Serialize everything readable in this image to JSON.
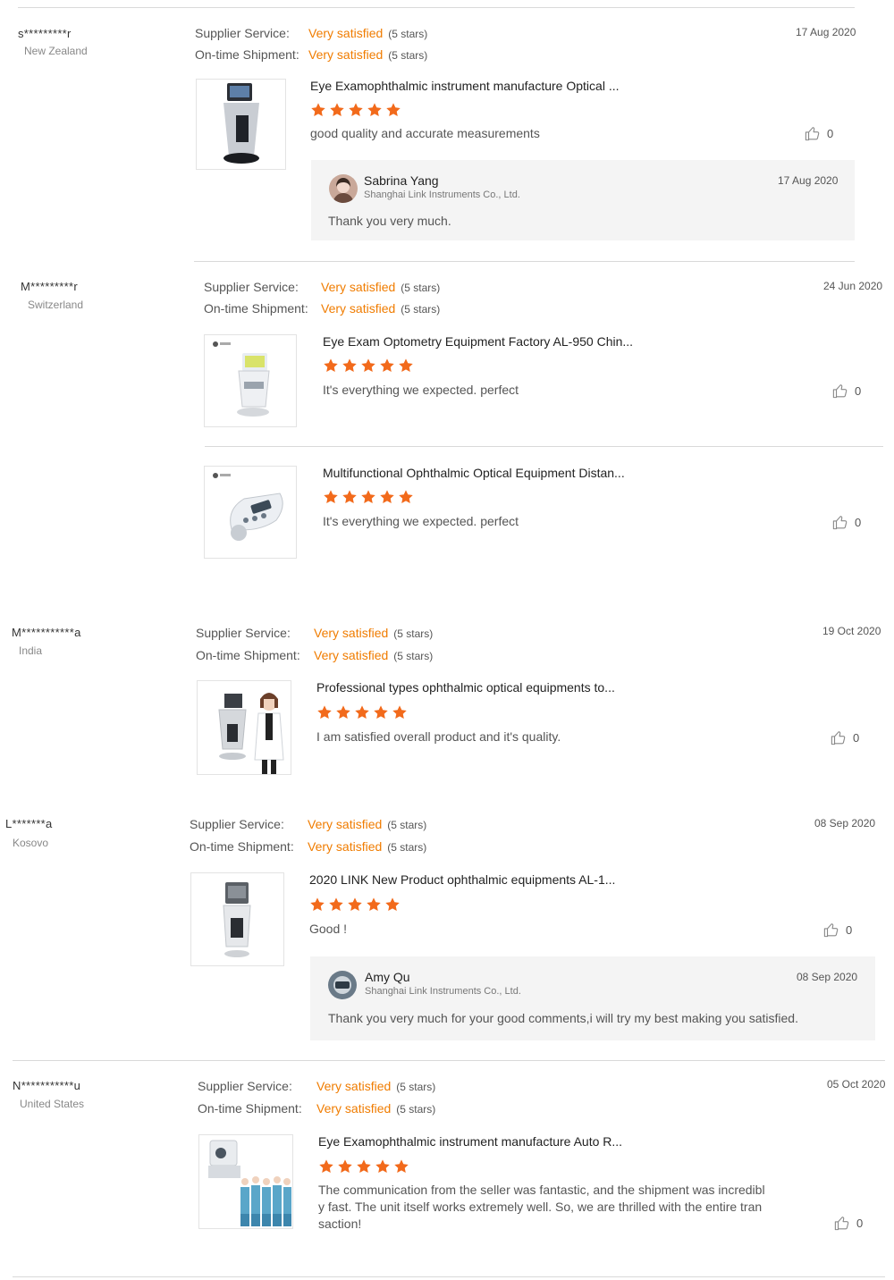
{
  "labels": {
    "supplier_service": "Supplier Service:",
    "ontime_shipment": "On-time Shipment:",
    "very_satisfied": "Very satisfied",
    "five_stars": "(5 stars)"
  },
  "colors": {
    "accent": "#f07c00",
    "star": "#f26a1b",
    "divider": "#d9d9d9",
    "reply_bg": "#f4f4f4"
  },
  "reviews": [
    {
      "buyer": "s*********r",
      "country": "New Zealand",
      "date": "17 Aug 2020",
      "products": [
        {
          "title": "Eye Examophthalmic instrument manufacture Optical ...",
          "rating": 5,
          "comment": "good quality and accurate measurements",
          "likes": "0",
          "thumb_icon": "lensmeter-icon"
        }
      ],
      "reply": {
        "name": "Sabrina Yang",
        "company": "Shanghai Link Instruments Co., Ltd.",
        "date": "17 Aug 2020",
        "text": "Thank you very much."
      }
    },
    {
      "buyer": "M*********r",
      "country": "Switzerland",
      "date": "24 Jun 2020",
      "products": [
        {
          "title": "Eye Exam Optometry Equipment Factory AL-950 Chin...",
          "rating": 5,
          "comment": "It's everything we expected. perfect",
          "likes": "0",
          "thumb_icon": "lensmeter-icon"
        },
        {
          "title": "Multifunctional Ophthalmic Optical Equipment Distan...",
          "rating": 5,
          "comment": "It's everything we expected. perfect",
          "likes": "0",
          "thumb_icon": "pd-meter-icon"
        }
      ]
    },
    {
      "buyer": "M***********a",
      "country": "India",
      "date": "19 Oct 2020",
      "products": [
        {
          "title": "Professional types ophthalmic optical equipments to...",
          "rating": 5,
          "comment": "I am satisfied overall product and it's quality.",
          "likes": "0",
          "thumb_icon": "lensmeter-doctor-icon"
        }
      ]
    },
    {
      "buyer": "L*******a",
      "country": "Kosovo",
      "date": "08 Sep 2020",
      "products": [
        {
          "title": "2020 LINK New Product ophthalmic equipments AL-1...",
          "rating": 5,
          "comment": "Good !",
          "likes": "0",
          "thumb_icon": "lensmeter-icon"
        }
      ],
      "reply": {
        "name": "Amy Qu",
        "company": "Shanghai Link Instruments Co., Ltd.",
        "date": "08 Sep 2020",
        "text": "Thank you very much for your good comments,i will try my best making you satisfied."
      }
    },
    {
      "buyer": "N***********u",
      "country": "United States",
      "date": "05 Oct 2020",
      "products": [
        {
          "title": "Eye Examophthalmic instrument manufacture Auto R...",
          "rating": 5,
          "comment_lines": [
            "The communication from the seller was fantastic, and the shipment was incredibl",
            "y fast.  The unit itself works extremely well.  So, we are thrilled with the entire tran",
            "saction!"
          ],
          "likes": "0",
          "thumb_icon": "autorefractor-team-icon"
        }
      ]
    }
  ]
}
